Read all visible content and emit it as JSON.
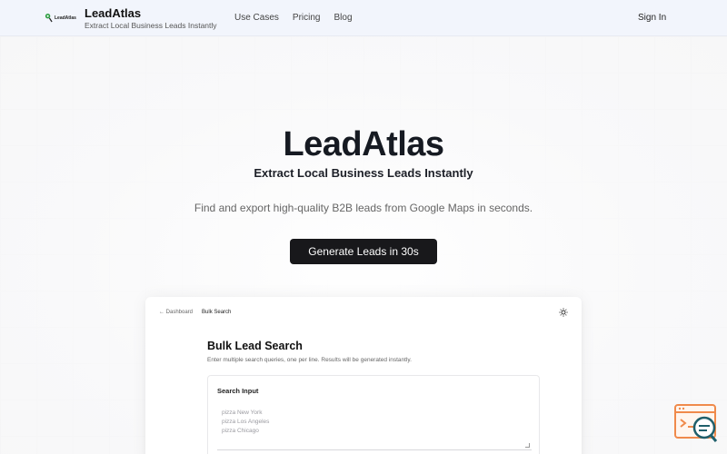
{
  "header": {
    "logo_small": "LeadAtlas",
    "brand_title": "LeadAtlas",
    "brand_sub": "Extract Local Business Leads Instantly",
    "nav": [
      "Use Cases",
      "Pricing",
      "Blog"
    ],
    "signin": "Sign In"
  },
  "hero": {
    "title": "LeadAtlas",
    "subtitle": "Extract Local Business Leads Instantly",
    "description": "Find and export high-quality B2B leads from Google Maps in seconds.",
    "cta": "Generate Leads in 30s"
  },
  "preview": {
    "breadcrumb_back": "← Dashboard",
    "breadcrumb_current": "Bulk Search",
    "title": "Bulk Lead Search",
    "description": "Enter multiple search queries, one per line. Results will be generated instantly.",
    "input_label": "Search Input",
    "placeholder_lines": [
      "pizza New York",
      "pizza Los Angeles",
      "pizza Chicago"
    ]
  },
  "icons": {
    "logo": "map-pin-search-icon",
    "theme": "sun-icon",
    "chat": "chat-search-icon"
  },
  "colors": {
    "header_bg": "#f2f5fc",
    "cta_bg": "#18181b",
    "accent_green": "#2f9e44",
    "widget_orange": "#f08a4b",
    "widget_teal": "#1f5f6b"
  }
}
